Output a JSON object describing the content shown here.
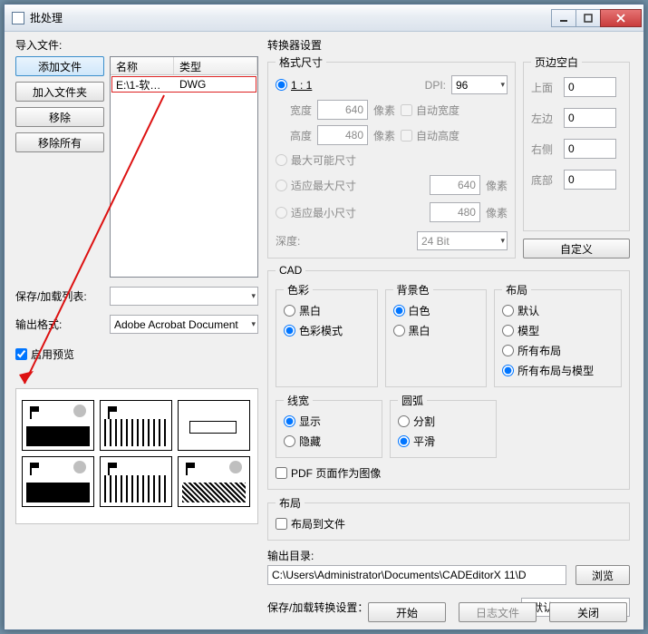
{
  "window": {
    "title": "批处理"
  },
  "left": {
    "import_label": "导入文件:",
    "buttons": {
      "add_file": "添加文件",
      "add_folder": "加入文件夹",
      "remove": "移除",
      "remove_all": "移除所有"
    },
    "table": {
      "col_name": "名称",
      "col_type": "类型",
      "row_name": "E:\\1-软文...",
      "row_type": "DWG"
    },
    "savelist_label": "保存/加载列表:",
    "format_label": "输出格式:",
    "format_value": "Adobe Acrobat Document",
    "enable_preview": "启用预览"
  },
  "right": {
    "converter_title": "转换器设置",
    "fmt_title": "格式尺寸",
    "r_1_1": "1 : 1",
    "dpi_label": "DPI:",
    "dpi_value": "96",
    "w_label": "宽度",
    "w_value": "640",
    "px_unit": "像素",
    "auto_w": "自动宽度",
    "h_label": "高度",
    "h_value": "480",
    "auto_h": "自动高度",
    "r_max": "最大可能尺寸",
    "r_fitmax": "适应最大尺寸",
    "fitmax_v": "640",
    "r_fitmin": "适应最小尺寸",
    "fitmin_v": "480",
    "depth_label": "深度:",
    "depth_value": "24 Bit",
    "margin_title": "页边空白",
    "m_top": "上面",
    "m_left": "左边",
    "m_right": "右侧",
    "m_bottom": "底部",
    "m_val": "0",
    "custom_btn": "自定义",
    "cad_title": "CAD",
    "color_title": "色彩",
    "color_bw": "黑白",
    "color_mode": "色彩模式",
    "bg_title": "背景色",
    "bg_white": "白色",
    "bg_black": "黑白",
    "layout_title": "布局",
    "layout_default": "默认",
    "layout_model": "模型",
    "layout_all": "所有布局",
    "layout_allm": "所有布局与模型",
    "lw_title": "线宽",
    "lw_show": "显示",
    "lw_hide": "隐藏",
    "arc_title": "圆弧",
    "arc_split": "分割",
    "arc_smooth": "平滑",
    "pdf_as_image": "PDF 页面作为图像",
    "layout2_title": "布局",
    "layout_to_file": "布局到文件",
    "outdir_label": "输出目录:",
    "outdir_value": "C:\\Users\\Administrator\\Documents\\CADEditorX 11\\D",
    "browse_btn": "浏览",
    "saveconv_label": "保存/加载转换设置：:",
    "saveconv_value": "<默认>"
  },
  "footer": {
    "start": "开始",
    "log": "日志文件",
    "close": "关闭"
  }
}
